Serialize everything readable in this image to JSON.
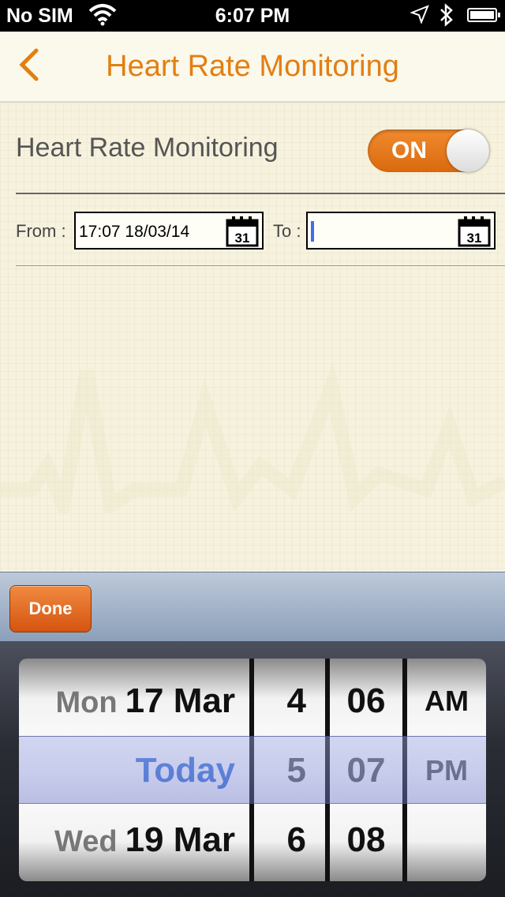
{
  "status_bar": {
    "carrier": "No SIM",
    "time": "6:07 PM"
  },
  "nav": {
    "title": "Heart Rate Monitoring"
  },
  "settings": {
    "hrm_label": "Heart Rate Monitoring",
    "toggle_text": "ON",
    "toggle_state": "on",
    "accent_color": "#e27f12"
  },
  "range": {
    "from_label": "From :",
    "from_value": "17:07 18/03/14",
    "to_label": "To :",
    "to_value": "",
    "calendar_day": "31"
  },
  "toolbar": {
    "done_label": "Done"
  },
  "picker": {
    "date_rows": [
      {
        "weekday": "Mon",
        "date": "17 Mar"
      },
      {
        "weekday": "",
        "date": "Today"
      },
      {
        "weekday": "Wed",
        "date": "19 Mar"
      }
    ],
    "hours": [
      "4",
      "5",
      "6"
    ],
    "minutes": [
      "06",
      "07",
      "08"
    ],
    "ampm": [
      "AM",
      "PM",
      ""
    ]
  }
}
